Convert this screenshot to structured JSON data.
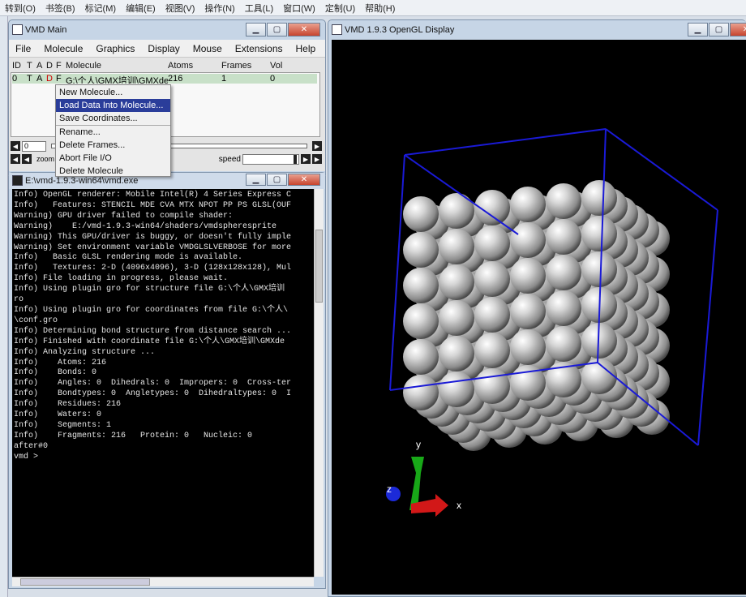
{
  "topbar": {
    "items": [
      "转到(O)",
      "书签(B)",
      "标记(M)",
      "编辑(E)",
      "视图(V)",
      "操作(N)",
      "工具(L)",
      "窗口(W)",
      "定制(U)",
      "帮助(H)"
    ]
  },
  "main": {
    "title": "VMD Main",
    "menu": [
      "File",
      "Molecule",
      "Graphics",
      "Display",
      "Mouse",
      "Extensions",
      "Help"
    ],
    "columns": [
      "ID",
      "T",
      "A",
      "D",
      "F",
      "Molecule",
      "Atoms",
      "Frames",
      "Vol"
    ],
    "row": {
      "id": "0",
      "t": "T",
      "a": "A",
      "d": "D",
      "f": "F",
      "molecule": "G:\\个人\\GMX培训\\GMXde",
      "atoms": "216",
      "frames": "1",
      "vol": "0"
    },
    "frame_value": "0",
    "zoom_label": "zoom",
    "speed_label": "speed"
  },
  "menu_popup": {
    "items": [
      "New Molecule...",
      "Load Data Into Molecule...",
      "Save Coordinates...",
      "Rename...",
      "Delete Frames...",
      "Abort File I/O",
      "Delete Molecule"
    ],
    "selected_index": 1
  },
  "console": {
    "title": "E:\\vmd-1.9.3-win64\\vmd.exe",
    "lines": [
      "Info) OpenGL renderer: Mobile Intel(R) 4 Series Express C",
      "Info)   Features: STENCIL MDE CVA MTX NPOT PP PS GLSL(OUF",
      "Warning) GPU driver failed to compile shader:",
      "Warning)    E:/vmd-1.9.3-win64/shaders/vmdspheresprite",
      "Warning) This GPU/driver is buggy, or doesn't fully imple",
      "Warning) Set environment variable VMDGLSLVERBOSE for more",
      "Info)   Basic GLSL rendering mode is available.",
      "Info)   Textures: 2-D (4096x4096), 3-D (128x128x128), Mul",
      "Info) File loading in progress, please wait.",
      "Info) Using plugin gro for structure file G:\\个人\\GMX培训",
      "ro",
      "Info) Using plugin gro for coordinates from file G:\\个人\\",
      "\\conf.gro",
      "Info) Determining bond structure from distance search ...",
      "Info) Finished with coordinate file G:\\个人\\GMX培训\\GMXde",
      "Info) Analyzing structure ...",
      "Info)    Atoms: 216",
      "Info)    Bonds: 0",
      "Info)    Angles: 0  Dihedrals: 0  Impropers: 0  Cross-ter",
      "Info)    Bondtypes: 0  Angletypes: 0  Dihedraltypes: 0  I",
      "Info)    Residues: 216",
      "Info)    Waters: 0",
      "Info)    Segments: 1",
      "Info)    Fragments: 216   Protein: 0   Nucleic: 0",
      "after#0",
      "vmd > "
    ]
  },
  "gl": {
    "title": "VMD 1.9.3 OpenGL Display",
    "axes": {
      "x": "x",
      "y": "y",
      "z": "z"
    },
    "box_color": "#1a1ad6",
    "sphere_color": "#c8c8c8"
  }
}
